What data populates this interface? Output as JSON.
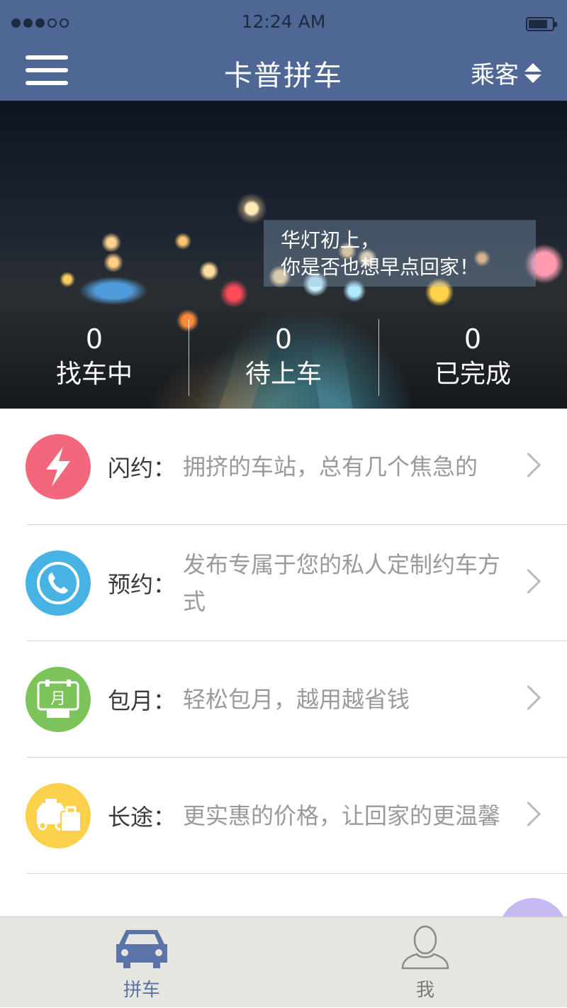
{
  "status_bar": {
    "time": "12:24 AM",
    "signal_bars_filled": 3,
    "signal_bars_total": 5
  },
  "nav": {
    "title": "卡普拼车",
    "role": "乘客",
    "menu_icon": "menu-icon",
    "switch_icon": "updown-arrows-icon"
  },
  "hero": {
    "caption_line1": "华灯初上，",
    "caption_line2": "你是否也想早点回家！",
    "stats": [
      {
        "value": "0",
        "label": "找车中"
      },
      {
        "value": "0",
        "label": "待上车"
      },
      {
        "value": "0",
        "label": "已完成"
      }
    ]
  },
  "services": [
    {
      "name": "闪约：",
      "desc": "拥挤的车站，总有几个焦急的",
      "icon": "lightning-icon",
      "color": "#f2677b"
    },
    {
      "name": "预约：",
      "desc": "发布专属于您的私人定制约车方式",
      "icon": "phone-icon",
      "color": "#47b3e4"
    },
    {
      "name": "包月：",
      "desc": "轻松包月，越用越省钱",
      "icon": "monthly-calendar-icon",
      "color": "#7cc45a"
    },
    {
      "name": "长途：",
      "desc": "更实惠的价格，让回家的更温馨",
      "icon": "taxi-luggage-icon",
      "color": "#fbd14b"
    }
  ],
  "tabbar": {
    "tabs": [
      {
        "label": "拼车",
        "icon": "car-icon",
        "active": true
      },
      {
        "label": "我",
        "icon": "person-icon",
        "active": false
      }
    ],
    "active_color": "#5a74a8"
  },
  "theme": {
    "primary": "#4e6795",
    "background": "#ffffff"
  }
}
